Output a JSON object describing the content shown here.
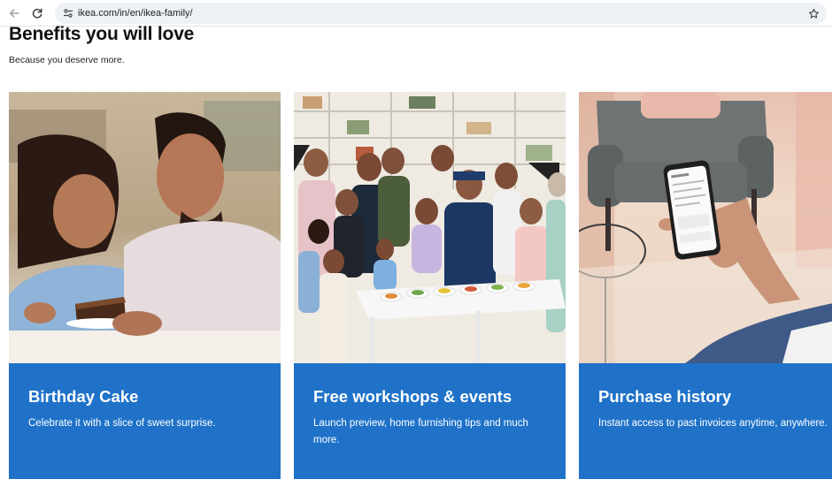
{
  "browser": {
    "url": "ikea.com/in/en/ikea-family/"
  },
  "page": {
    "title": "Benefits you will love",
    "subtitle": "Because you deserve more."
  },
  "cards": [
    {
      "title": "Birthday Cake",
      "description": "Celebrate it with a slice of sweet surprise.",
      "image": "couple-with-birthday-cake-photo"
    },
    {
      "title": "Free workshops & events",
      "description": "Launch preview, home furnishing tips and much more.",
      "image": "family-workshop-with-chef-photo"
    },
    {
      "title": "Purchase history",
      "description": "Instant access to past invoices anytime, anywhere.",
      "image": "hand-holding-phone-photo"
    }
  ],
  "colors": {
    "card_panel": "#1f72c8",
    "card_text": "#ffffff"
  }
}
